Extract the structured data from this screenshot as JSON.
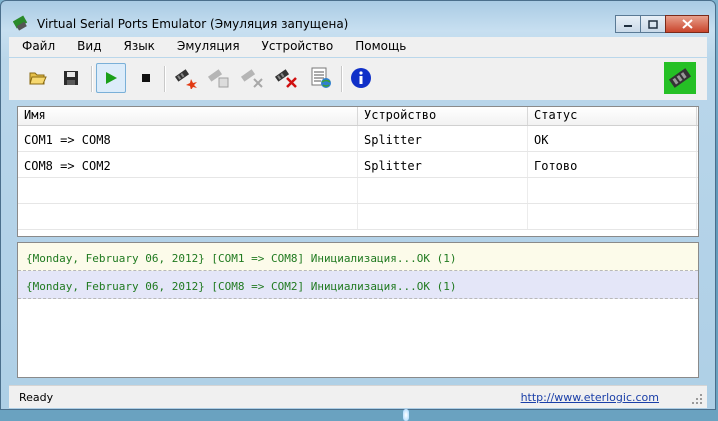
{
  "window": {
    "title": "Virtual Serial Ports Emulator (Эмуляция запущена)"
  },
  "menu": [
    "Файл",
    "Вид",
    "Язык",
    "Эмуляция",
    "Устройство",
    "Помощь"
  ],
  "toolbar": {
    "icons": [
      "open-folder-icon",
      "save-icon",
      "play-icon",
      "stop-icon",
      "new-device-icon",
      "device-properties-icon",
      "disable-device-icon",
      "delete-device-icon",
      "device-list-icon",
      "info-icon",
      "app-logo-icon"
    ]
  },
  "grid": {
    "headers": [
      "Имя",
      "Устройство",
      "Статус"
    ],
    "rows": [
      [
        "COM1 => COM8",
        "Splitter",
        "OK"
      ],
      [
        "COM8 => COM2",
        "Splitter",
        "Готово"
      ]
    ]
  },
  "log": [
    "{Monday, February 06, 2012} [COM1 => COM8] Инициализация...OK (1)",
    "{Monday, February 06, 2012} [COM8 => COM2] Инициализация...OK (1)"
  ],
  "status": {
    "text": "Ready",
    "link": "http://www.eterlogic.com"
  },
  "colors": {
    "log_text": "#207a20",
    "link": "#1a3fa8",
    "play_green": "#1aa01a"
  }
}
